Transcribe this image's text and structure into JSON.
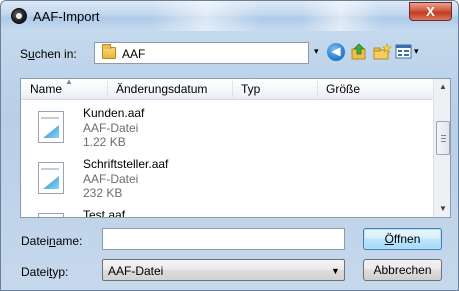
{
  "window": {
    "title": "AAF-Import",
    "close_glyph": "X"
  },
  "lookin": {
    "label_prefix": "S",
    "label_underline": "u",
    "label_rest": "chen in:",
    "value": "AAF",
    "folder_icon": "folder-icon"
  },
  "toolbar": {
    "back_glyph": "◀",
    "combo_arrow": "▾",
    "view_arrow": "▾"
  },
  "columns": {
    "name": "Name",
    "modified": "Änderungsdatum",
    "type": "Typ",
    "size": "Größe"
  },
  "files": [
    {
      "name": "Kunden.aaf",
      "type": "AAF-Datei",
      "size": "1.22 KB"
    },
    {
      "name": "Schriftsteller.aaf",
      "type": "AAF-Datei",
      "size": "232 KB"
    },
    {
      "name": "Test.aaf",
      "type": "",
      "size": ""
    }
  ],
  "filename": {
    "label_prefix": "Datei",
    "label_underline": "n",
    "label_rest": "ame:",
    "value": ""
  },
  "filetype": {
    "label_prefix": "Datei",
    "label_underline": "t",
    "label_rest": "yp:",
    "value": "AAF-Datei"
  },
  "buttons": {
    "open_prefix": "Ö",
    "open_rest": "ffnen",
    "cancel": "Abbrechen"
  },
  "colors": {
    "title_bar": "#c2d7ee",
    "close_button": "#d2583f",
    "open_button": "#bee6fd",
    "secondary_text": "#6d6d6d"
  }
}
